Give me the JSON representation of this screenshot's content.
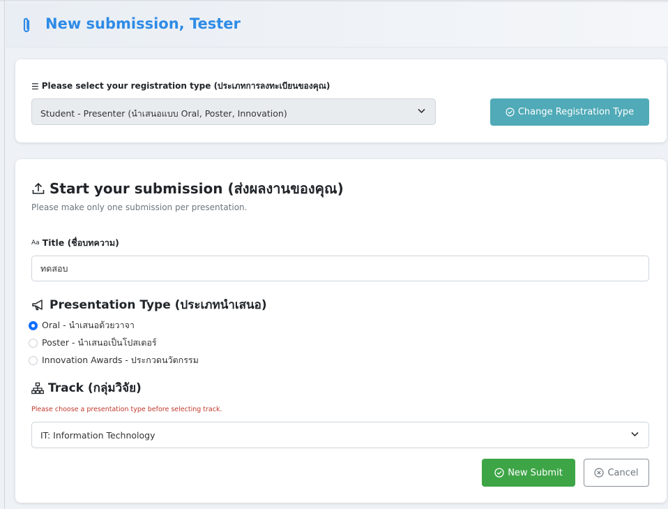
{
  "header": {
    "title": "New submission, Tester",
    "icon": "paperclip-icon",
    "color": "#2e8be6"
  },
  "registration": {
    "label": "Please select your registration type (ประเภทการลงทะเบียนของคุณ)",
    "label_icon": "list-icon",
    "selected": "Student - Presenter (นำเสนอแบบ Oral, Poster, Innovation)",
    "change_button": "Change Registration Type",
    "change_button_icon": "check-circle-icon",
    "button_color": "#50aab7"
  },
  "submission": {
    "title": "Start your submission (ส่งผลงานของคุณ)",
    "title_icon": "upload-icon",
    "description": "Please make only one submission per presentation.",
    "title_field_label": "Title (ชื่อบทความ)",
    "title_field_icon_text": "Aa",
    "title_field_value": "ทดสอบ",
    "presentation_type": {
      "heading": "Presentation Type (ประเภทนำเสนอ)",
      "icon": "megaphone-icon",
      "options": [
        {
          "label": "Oral - นำเสนอด้วยวาจา",
          "checked": true
        },
        {
          "label": "Poster - นำเสนอเป็นโปสเตอร์",
          "checked": false
        },
        {
          "label": "Innovation Awards - ประกวดนวัตกรรม",
          "checked": false
        }
      ]
    },
    "track": {
      "heading": "Track (กลุ่มวิจัย)",
      "icon": "sitemap-icon",
      "hint": "Please choose a presentation type before selecting track.",
      "selected": "IT: Information Technology"
    },
    "submit_button": "New Submit",
    "submit_icon": "check-circle-icon",
    "cancel_button": "Cancel",
    "cancel_icon": "x-circle-icon",
    "submit_color": "#3ea547",
    "radio_color": "#0d6efd"
  }
}
